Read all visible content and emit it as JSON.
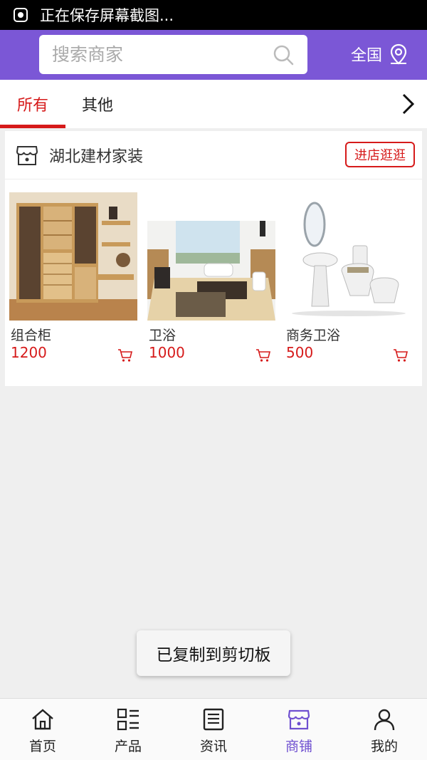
{
  "status_bar": {
    "text": "正在保存屏幕截图...",
    "icon": "screenshot-icon"
  },
  "header": {
    "search": {
      "placeholder": "搜索商家",
      "icon": "search-icon"
    },
    "region": {
      "label": "全国",
      "icon": "location-pin-icon"
    },
    "accent_color": "#7b57d6"
  },
  "tabs": [
    {
      "label": "所有",
      "active": true
    },
    {
      "label": "其他",
      "active": false
    }
  ],
  "tabs_more_icon": "chevron-right-icon",
  "shop": {
    "name": "湖北建材家装",
    "icon": "store-icon",
    "enter_label": "进店逛逛",
    "products": [
      {
        "name": "组合柜",
        "price": "1200",
        "image": "wooden-cabinet"
      },
      {
        "name": "卫浴",
        "price": "1000",
        "image": "bathroom"
      },
      {
        "name": "商务卫浴",
        "price": "500",
        "image": "toilet-basin-set"
      }
    ]
  },
  "toast": {
    "text": "已复制到剪切板"
  },
  "bottom_nav": [
    {
      "label": "首页",
      "icon": "home-icon",
      "active": false
    },
    {
      "label": "产品",
      "icon": "grid-list-icon",
      "active": false
    },
    {
      "label": "资讯",
      "icon": "news-icon",
      "active": false
    },
    {
      "label": "商铺",
      "icon": "store-icon",
      "active": true
    },
    {
      "label": "我的",
      "icon": "user-icon",
      "active": false
    }
  ],
  "colors": {
    "price_red": "#d61a1a",
    "nav_active": "#6e4fd0"
  }
}
